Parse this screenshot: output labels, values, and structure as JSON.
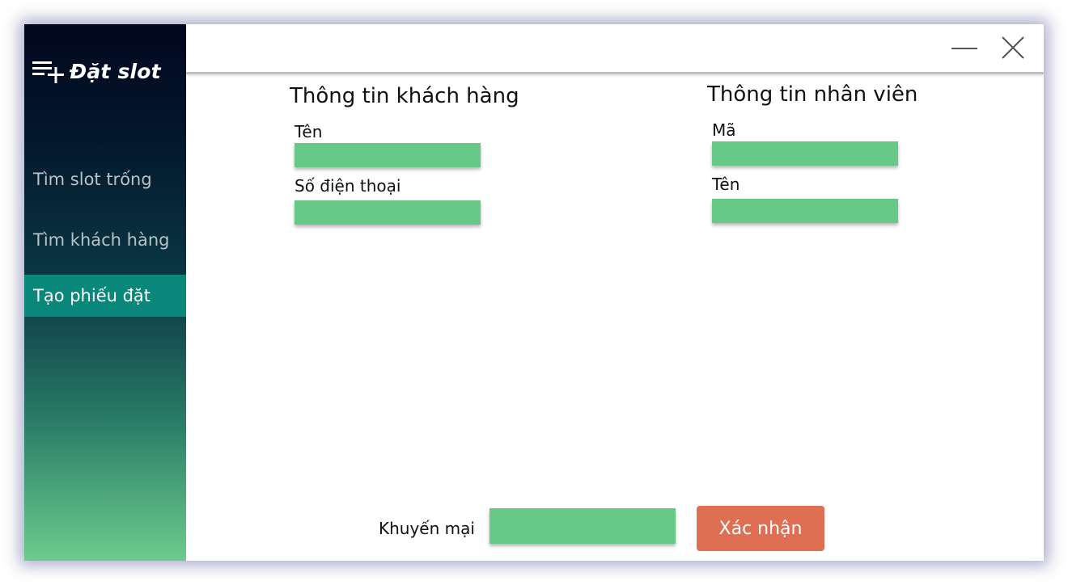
{
  "app": {
    "title": "Đặt slot",
    "logo_icon": "playlist-add-icon"
  },
  "sidebar": {
    "items": [
      {
        "label": "Tìm slot trống",
        "active": false
      },
      {
        "label": "Tìm khách hàng",
        "active": false
      },
      {
        "label": "Tạo phiếu đặt",
        "active": true
      }
    ]
  },
  "window_controls": {
    "minimize_icon": "minimize-icon",
    "close_icon": "close-icon"
  },
  "customer": {
    "title": "Thông tin khách hàng",
    "name_label": "Tên",
    "name_value": "",
    "phone_label": "Số điện thoại",
    "phone_value": ""
  },
  "employee": {
    "title": "Thông tin nhân viên",
    "code_label": "Mã",
    "code_value": "",
    "name_label": "Tên",
    "name_value": ""
  },
  "footer": {
    "promo_label": "Khuyến mại",
    "promo_value": "",
    "confirm_label": "Xác nhận"
  },
  "colors": {
    "accent_active": "#08877a",
    "input_bg": "#68c887",
    "confirm_bg": "#df6f52"
  }
}
